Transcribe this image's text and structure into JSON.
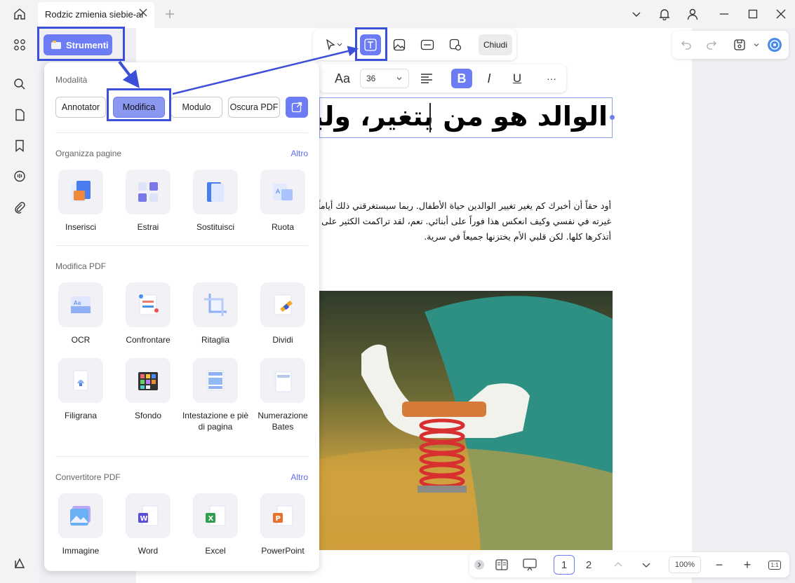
{
  "titlebar": {
    "tab_title": "Rodzic zmienia siebie-ar",
    "icons": [
      "home-icon",
      "close-icon",
      "plus-icon",
      "chevron-down-icon",
      "bell-icon",
      "user-icon",
      "minimize-icon",
      "maximize-icon",
      "close-icon"
    ]
  },
  "left_rail": {
    "icons": [
      "apps-icon",
      "search-icon",
      "pages-icon",
      "bookmark-icon",
      "comment-icon",
      "attachment-icon",
      "layers-icon"
    ]
  },
  "strumenti": {
    "label": "Strumenti"
  },
  "edit_toolbar": {
    "close_label": "Chiudi",
    "icons": [
      "cursor-icon",
      "text-icon",
      "image-icon",
      "link-icon",
      "shape-icon"
    ]
  },
  "font_toolbar": {
    "font_label": "Aa",
    "size": "36",
    "bold": "B",
    "italic": "I",
    "underline": "U",
    "more": "···"
  },
  "document": {
    "heading": "الوالد هو من يتغير، وليس",
    "paragraph": [
      "أود حقاً أن أخبرك كم يغير تغيير الوالدين حياة الأطفال. ربما سيستغرقني ذلك أياماً",
      "غيرته في نفسي وكيف انعكس هذا فوراً على أبنائي. نعم، لقد تراكمت الكثير على مر",
      "أتذكرها كلها. لكن قلبي الأم يختزنها جميعاً في سرية."
    ]
  },
  "tools_panel": {
    "modes_title": "Modalità",
    "modes": [
      "Annotator",
      "Modifica",
      "Modulo",
      "Oscura PDF"
    ],
    "active_mode": "Modifica",
    "sections": [
      {
        "title": "Organizza pagine",
        "more": "Altro",
        "tools": [
          "Inserisci",
          "Estrai",
          "Sostituisci",
          "Ruota"
        ]
      },
      {
        "title": "Modifica PDF",
        "more": "",
        "tools": [
          "OCR",
          "Confrontare",
          "Ritaglia",
          "Dividi",
          "Filigrana",
          "Sfondo",
          "Intestazione e piè di pagina",
          "Numerazione Bates"
        ]
      },
      {
        "title": "Convertitore PDF",
        "more": "Altro",
        "tools": [
          "Immagine",
          "Word",
          "Excel",
          "PowerPoint"
        ]
      }
    ]
  },
  "bottom_bar": {
    "page_1": "1",
    "page_2": "2",
    "zoom": "100%",
    "minus": "−",
    "plus": "+",
    "fit": "1:1"
  },
  "colors": {
    "accent": "#6b7cf5",
    "callout": "#3b4fd8",
    "background": "#f3f3f6"
  }
}
